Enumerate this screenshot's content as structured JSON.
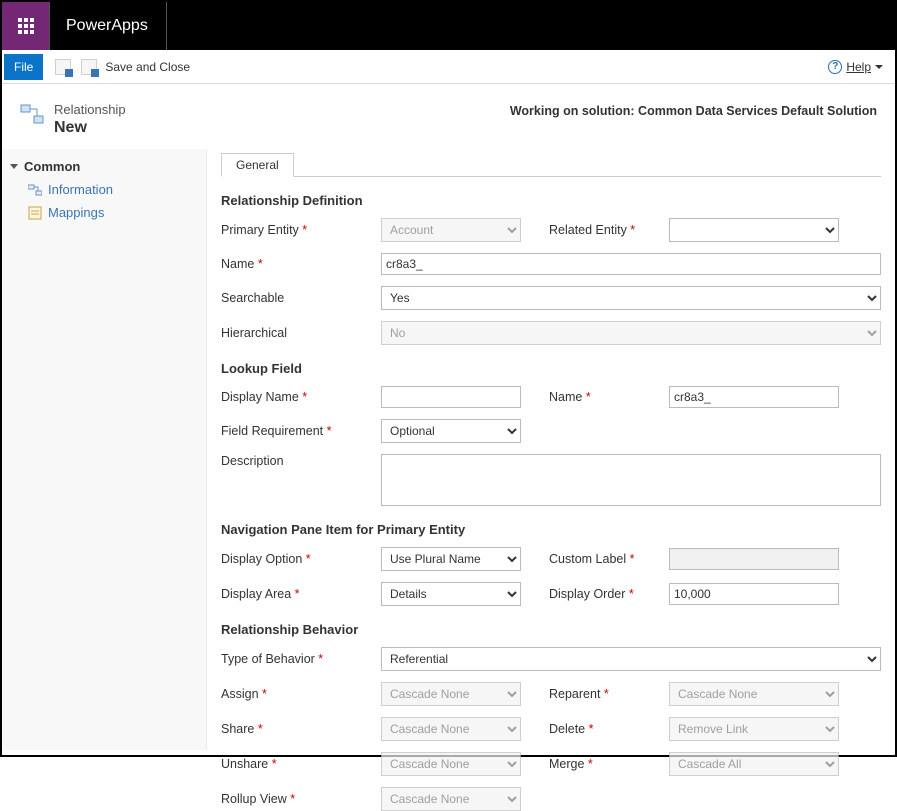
{
  "brand": "PowerApps",
  "toolbar": {
    "file": "File",
    "save_close": "Save and Close",
    "help": "Help"
  },
  "header": {
    "entity_label": "Relationship",
    "entity_state": "New",
    "solution_line": "Working on solution: Common Data Services Default Solution"
  },
  "side": {
    "group": "Common",
    "items": [
      "Information",
      "Mappings"
    ]
  },
  "tabs": {
    "general": "General"
  },
  "sections": {
    "rel_def": "Relationship Definition",
    "lookup": "Lookup Field",
    "nav": "Navigation Pane Item for Primary Entity",
    "behavior": "Relationship Behavior"
  },
  "labels": {
    "primary_entity": "Primary Entity",
    "related_entity": "Related Entity",
    "name": "Name",
    "searchable": "Searchable",
    "hierarchical": "Hierarchical",
    "display_name": "Display Name",
    "field_requirement": "Field Requirement",
    "description": "Description",
    "display_option": "Display Option",
    "custom_label": "Custom Label",
    "display_area": "Display Area",
    "display_order": "Display Order",
    "type_behavior": "Type of Behavior",
    "assign": "Assign",
    "reparent": "Reparent",
    "share": "Share",
    "delete": "Delete",
    "unshare": "Unshare",
    "merge": "Merge",
    "rollup_view": "Rollup View"
  },
  "values": {
    "primary_entity": "Account",
    "related_entity": "",
    "name": "cr8a3_",
    "searchable": "Yes",
    "hierarchical": "No",
    "display_name": "",
    "lookup_name": "cr8a3_",
    "field_requirement": "Optional",
    "description": "",
    "display_option": "Use Plural Name",
    "custom_label": "",
    "display_area": "Details",
    "display_order": "10,000",
    "type_behavior": "Referential",
    "assign": "Cascade None",
    "reparent": "Cascade None",
    "share": "Cascade None",
    "delete": "Remove Link",
    "unshare": "Cascade None",
    "merge": "Cascade All",
    "rollup_view": "Cascade None"
  }
}
